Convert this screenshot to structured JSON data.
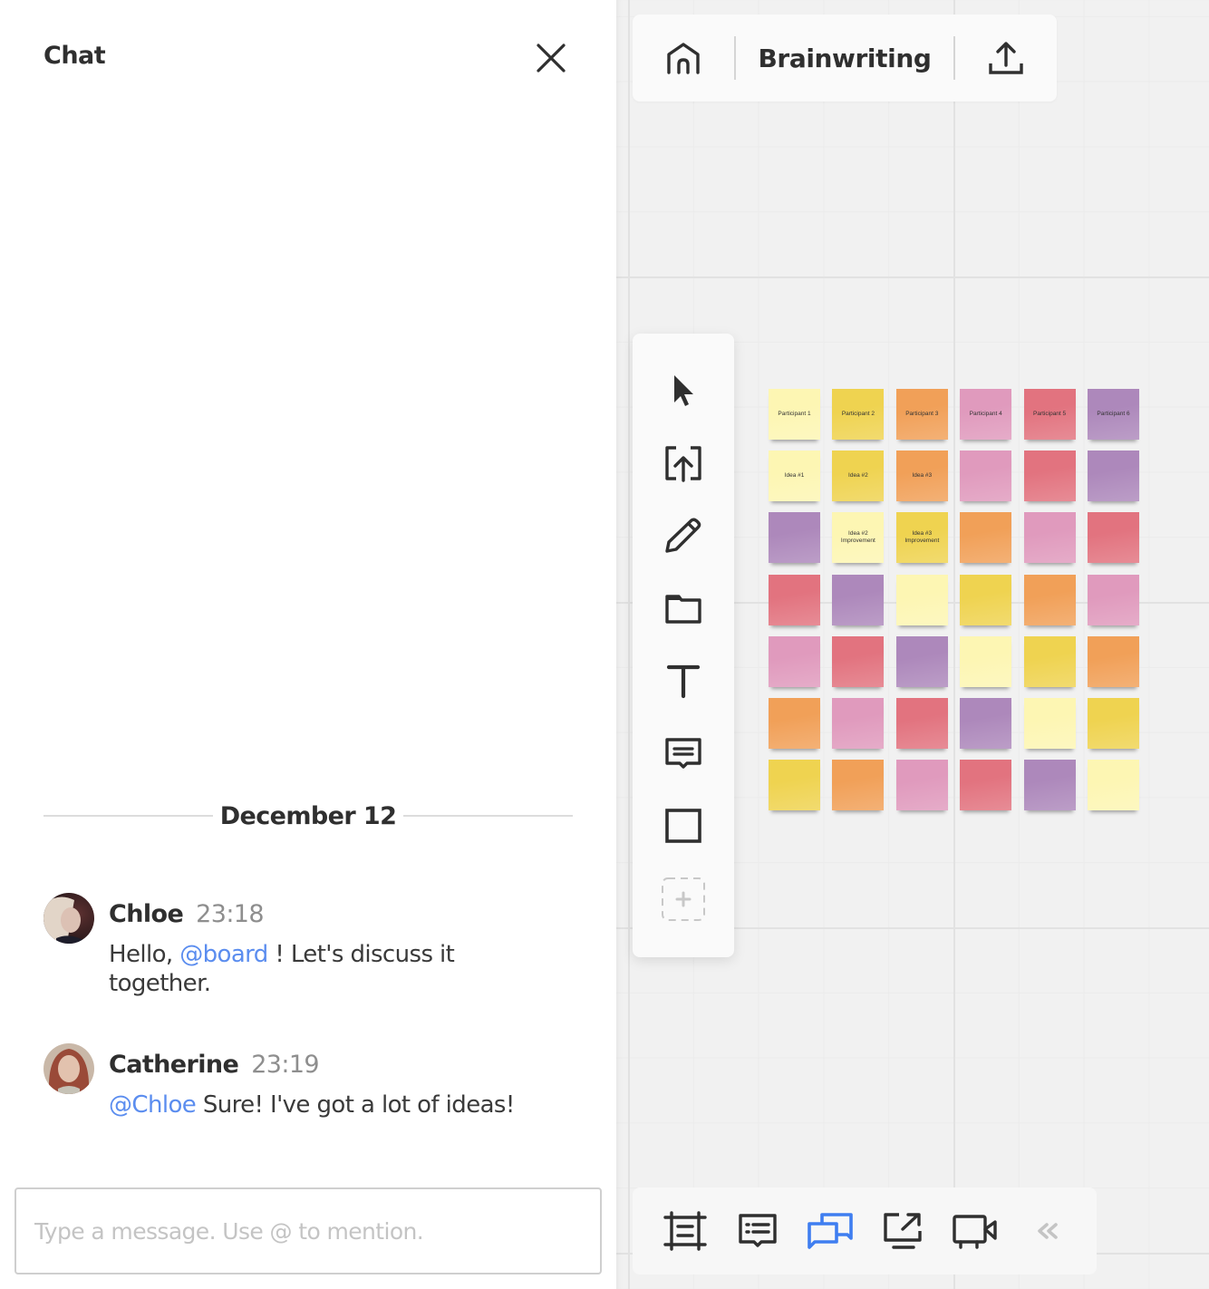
{
  "chat": {
    "title": "Chat",
    "close_icon": "close-icon",
    "date_separator": "December 12",
    "messages": [
      {
        "author": "Chloe",
        "time": "23:18",
        "text_before": "Hello, ",
        "mention": "@board",
        "text_after": " ! Let's discuss it together."
      },
      {
        "author": "Catherine",
        "time": "23:19",
        "text_before": "",
        "mention": "@Chloe",
        "text_after": " Sure! I've got a lot of ideas!"
      }
    ],
    "input": {
      "value": "",
      "placeholder": "Type a message. Use @ to mention."
    }
  },
  "board": {
    "name": "Brainwriting",
    "topbar_icons": [
      "home-icon",
      "share-upload-icon"
    ],
    "tools": [
      {
        "name": "select-tool",
        "icon": "cursor-icon"
      },
      {
        "name": "upload-tool",
        "icon": "upload-icon"
      },
      {
        "name": "pen-tool",
        "icon": "pencil-icon"
      },
      {
        "name": "frame-tool",
        "icon": "folder-icon"
      },
      {
        "name": "text-tool",
        "icon": "text-icon"
      },
      {
        "name": "comment-tool",
        "icon": "comment-icon"
      },
      {
        "name": "shape-tool",
        "icon": "rectangle-icon"
      },
      {
        "name": "more-tools",
        "icon": "add-icon"
      }
    ],
    "bottom_tools": [
      {
        "name": "frames",
        "icon": "frames-icon",
        "active": false
      },
      {
        "name": "comments",
        "icon": "comments-list-icon",
        "active": false
      },
      {
        "name": "chat",
        "icon": "chat-icon",
        "active": true
      },
      {
        "name": "screen-share",
        "icon": "screen-share-icon",
        "active": false
      },
      {
        "name": "video-call",
        "icon": "video-icon",
        "active": false
      },
      {
        "name": "collapse",
        "icon": "double-chevron-left-icon",
        "active": false
      }
    ],
    "colors": {
      "accent": "#3f7ef0",
      "light_yellow": "#fdf6b3",
      "yellow": "#efd350",
      "orange": "#f1a058",
      "pink": "#e09abd",
      "red": "#e2737f",
      "purple": "#ad88bb"
    },
    "sticky_notes": [
      [
        {
          "color": "light_yellow",
          "text": "Participant 1"
        },
        {
          "color": "yellow",
          "text": "Participant 2"
        },
        {
          "color": "orange",
          "text": "Participant 3"
        },
        {
          "color": "pink",
          "text": "Participant 4"
        },
        {
          "color": "red",
          "text": "Participant 5"
        },
        {
          "color": "purple",
          "text": "Participant 6"
        }
      ],
      [
        {
          "color": "light_yellow",
          "text": "Idea #1"
        },
        {
          "color": "yellow",
          "text": "Idea #2"
        },
        {
          "color": "orange",
          "text": "Idea #3"
        },
        {
          "color": "pink",
          "text": ""
        },
        {
          "color": "red",
          "text": ""
        },
        {
          "color": "purple",
          "text": ""
        }
      ],
      [
        {
          "color": "purple",
          "text": ""
        },
        {
          "color": "light_yellow",
          "text": "Idea #2 Improvement"
        },
        {
          "color": "yellow",
          "text": "Idea #3 Improvement"
        },
        {
          "color": "orange",
          "text": ""
        },
        {
          "color": "pink",
          "text": ""
        },
        {
          "color": "red",
          "text": ""
        }
      ],
      [
        {
          "color": "red",
          "text": ""
        },
        {
          "color": "purple",
          "text": ""
        },
        {
          "color": "light_yellow",
          "text": ""
        },
        {
          "color": "yellow",
          "text": ""
        },
        {
          "color": "orange",
          "text": ""
        },
        {
          "color": "pink",
          "text": ""
        }
      ],
      [
        {
          "color": "pink",
          "text": ""
        },
        {
          "color": "red",
          "text": ""
        },
        {
          "color": "purple",
          "text": ""
        },
        {
          "color": "light_yellow",
          "text": ""
        },
        {
          "color": "yellow",
          "text": ""
        },
        {
          "color": "orange",
          "text": ""
        }
      ],
      [
        {
          "color": "orange",
          "text": ""
        },
        {
          "color": "pink",
          "text": ""
        },
        {
          "color": "red",
          "text": ""
        },
        {
          "color": "purple",
          "text": ""
        },
        {
          "color": "light_yellow",
          "text": ""
        },
        {
          "color": "yellow",
          "text": ""
        }
      ],
      [
        {
          "color": "yellow",
          "text": ""
        },
        {
          "color": "orange",
          "text": ""
        },
        {
          "color": "pink",
          "text": ""
        },
        {
          "color": "red",
          "text": ""
        },
        {
          "color": "purple",
          "text": ""
        },
        {
          "color": "light_yellow",
          "text": ""
        }
      ]
    ]
  }
}
